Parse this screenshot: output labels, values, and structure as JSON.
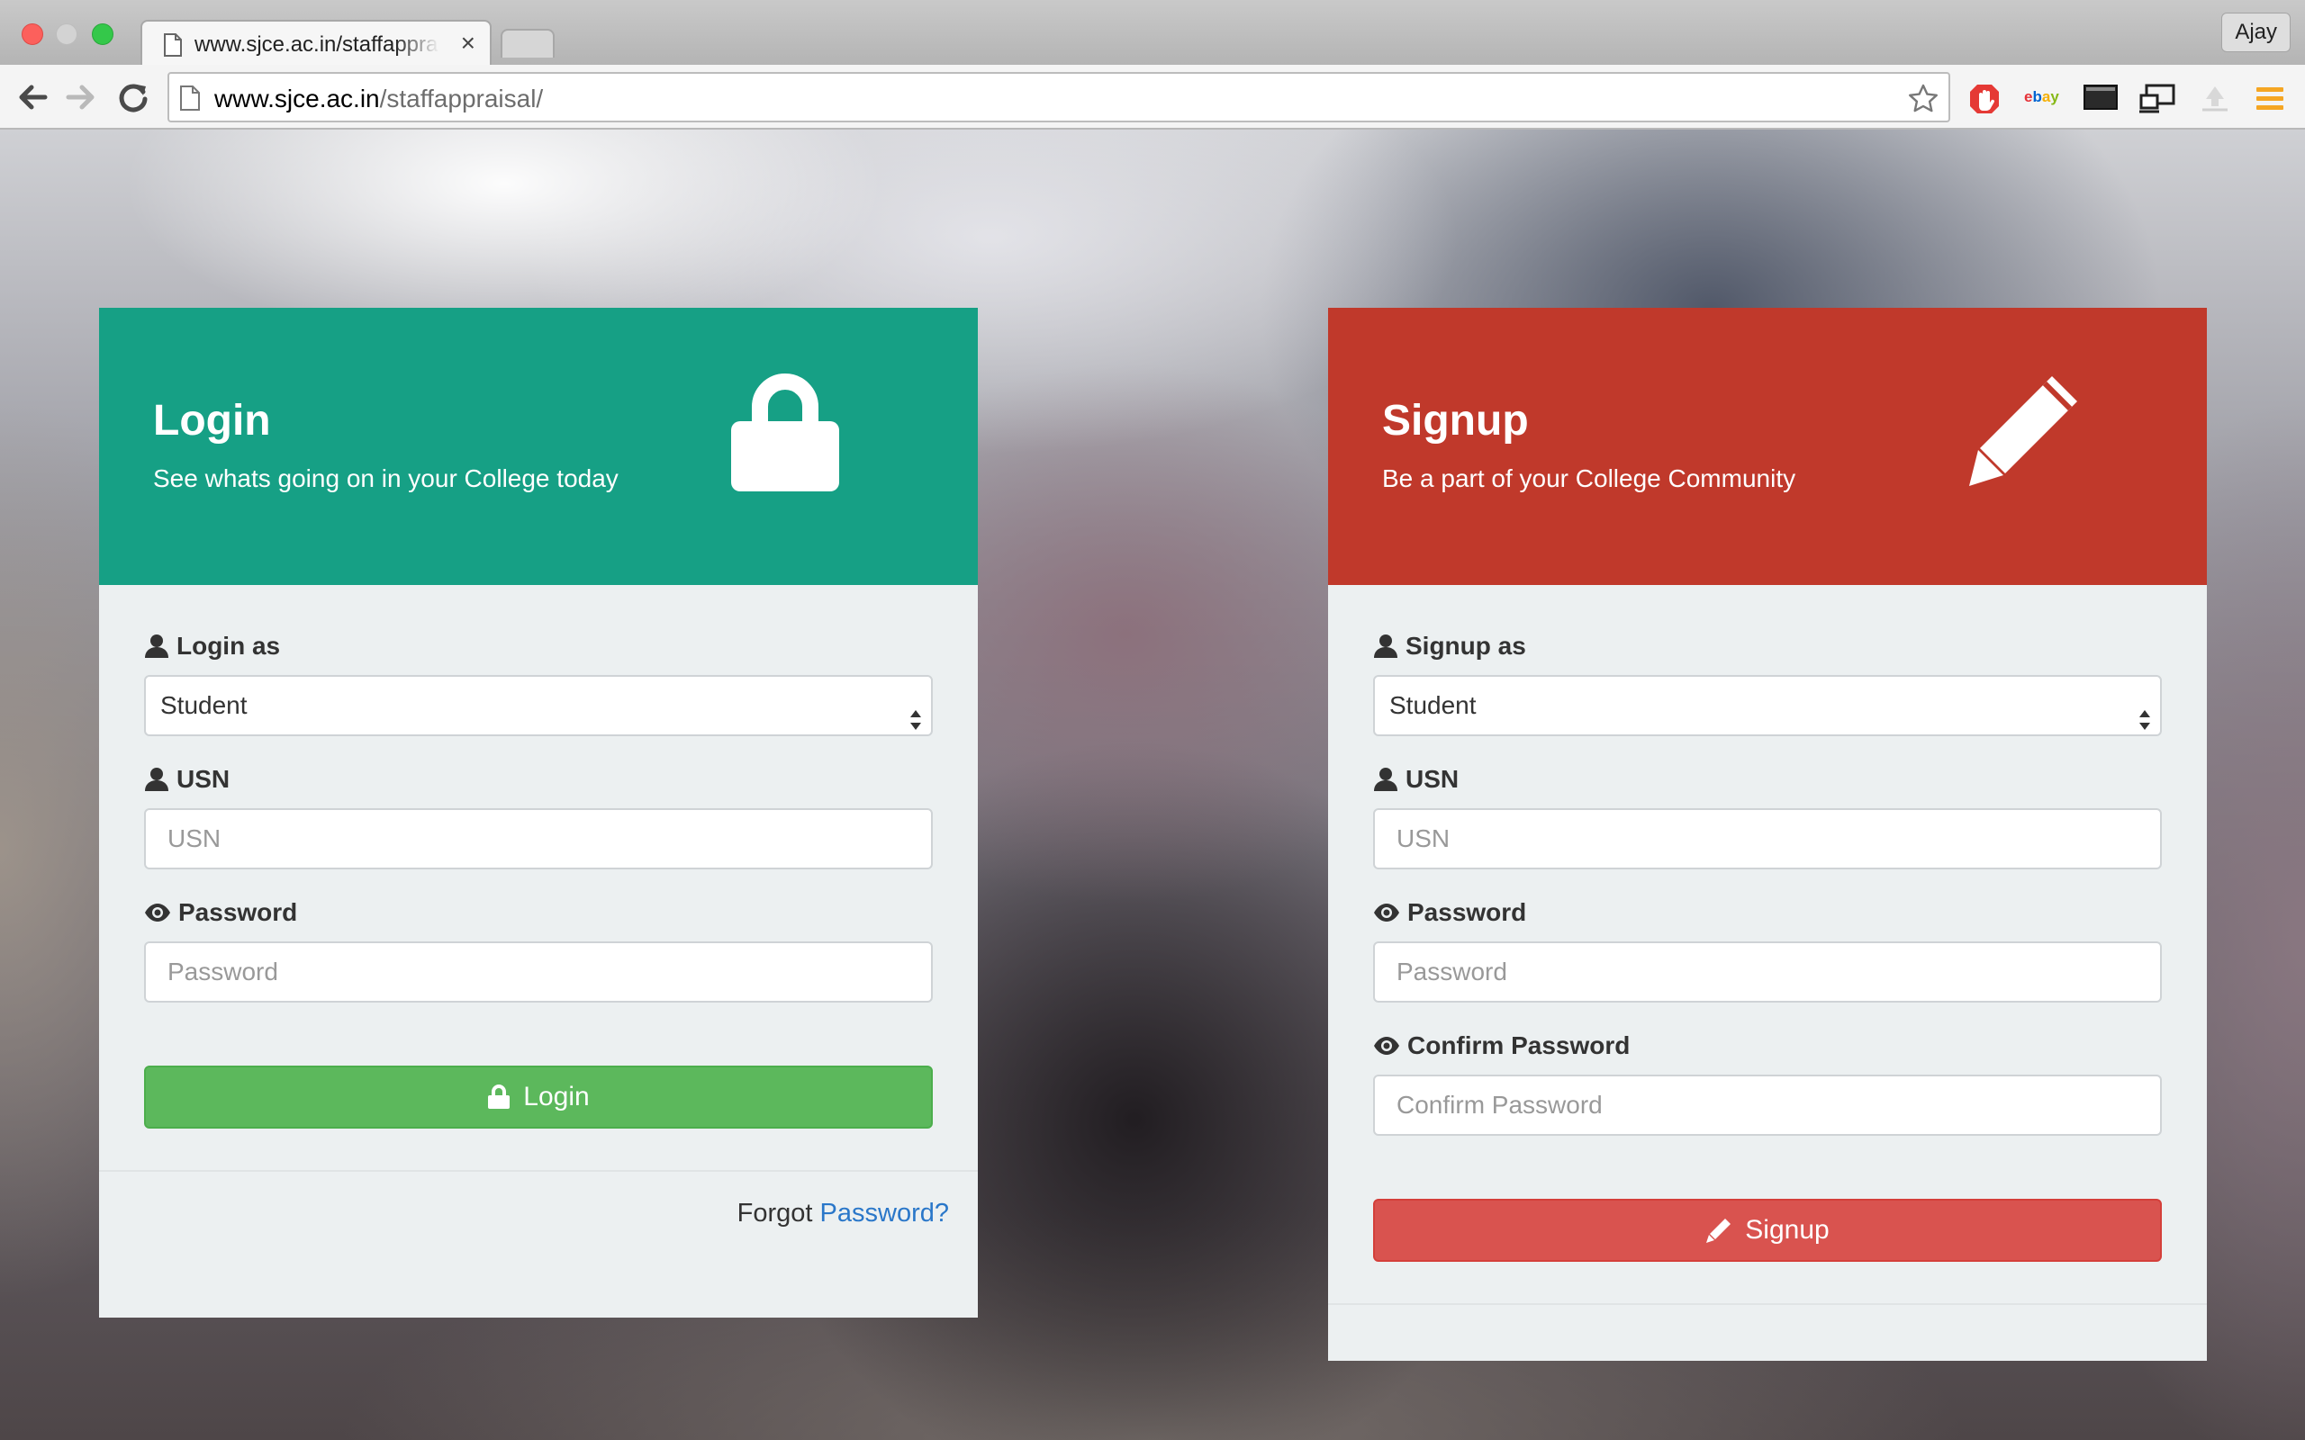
{
  "browser": {
    "tab_title": "www.sjce.ac.in/staffappraisal/",
    "tab_close": "×",
    "url_host": "www.sjce.ac.in",
    "url_path": "/staffappraisal/",
    "profile_name": "Ajay",
    "extensions": [
      "shield-icon",
      "ebay-icon",
      "terminal-icon",
      "cast-icon",
      "upload-icon",
      "menu-icon"
    ]
  },
  "login": {
    "title": "Login",
    "subtitle": "See whats going on in your College today",
    "role_label": "Login as",
    "role_value": "Student",
    "usn_label": "USN",
    "usn_placeholder": "USN",
    "password_label": "Password",
    "password_placeholder": "Password",
    "button_label": "Login",
    "forgot_text": "Forgot",
    "forgot_link": "Password?",
    "header_color": "#16a085",
    "button_color": "#5cb85c"
  },
  "signup": {
    "title": "Signup",
    "subtitle": "Be a part of your College Community",
    "role_label": "Signup as",
    "role_value": "Student",
    "usn_label": "USN",
    "usn_placeholder": "USN",
    "password_label": "Password",
    "password_placeholder": "Password",
    "confirm_label": "Confirm Password",
    "confirm_placeholder": "Confirm Password",
    "button_label": "Signup",
    "header_color": "#c0392b",
    "button_color": "#d9534f"
  }
}
